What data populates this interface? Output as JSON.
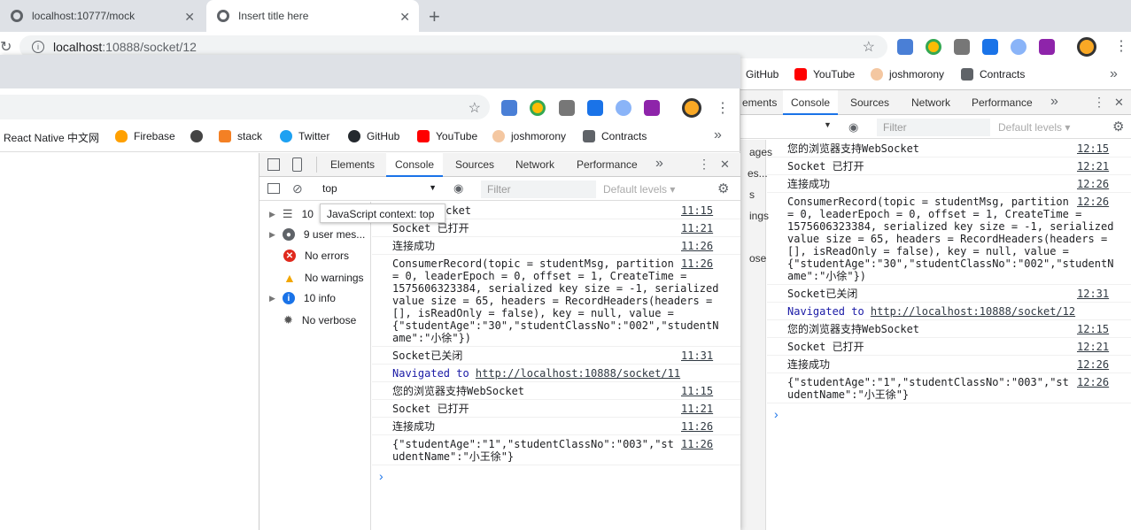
{
  "outer": {
    "tabs": [
      {
        "title": "localhost:10777/mock"
      },
      {
        "title": "Insert title here"
      }
    ],
    "new_tab": "+",
    "url_host": "localhost",
    "url_rest": ":10888/socket/12",
    "bookmarks": [
      "GitHub",
      "YouTube",
      "joshmorony",
      "Contracts"
    ],
    "bookmarks_more": "»",
    "devtools": {
      "tabs": [
        "ements",
        "Console",
        "Sources",
        "Network",
        "Performance"
      ],
      "more": "»",
      "filter_placeholder": "Filter",
      "levels": "Default levels ▾",
      "side_fragments": [
        "ages",
        "es...",
        "s",
        "ings",
        "ose"
      ],
      "messages": [
        {
          "text": "您的浏览器支持WebSocket",
          "src": "12:15"
        },
        {
          "text": "Socket 已打开",
          "src": "12:21"
        },
        {
          "text": "连接成功",
          "src": "12:26"
        },
        {
          "text": "ConsumerRecord(topic = studentMsg, partition\n= 0, leaderEpoch = 0, offset = 1, CreateTime =\n1575606323384, serialized key size = -1, serialized\nvalue size = 65, headers = RecordHeaders(headers =\n[], isReadOnly = false), key = null, value =\n{\"studentAge\":\"30\",\"studentClassNo\":\"002\",\"studentN\name\":\"小徐\"})",
          "src": "12:26"
        },
        {
          "text": "Socket已关闭",
          "src": "12:31"
        },
        {
          "nav": "Navigated to ",
          "link": "http://localhost:10888/socket/12"
        },
        {
          "text": "您的浏览器支持WebSocket",
          "src": "12:15"
        },
        {
          "text": "Socket 已打开",
          "src": "12:21"
        },
        {
          "text": "连接成功",
          "src": "12:26"
        },
        {
          "text": "{\"studentAge\":\"1\",\"studentClassNo\":\"003\",\"st\nudentName\":\"小王徐\"}",
          "src": "12:26"
        }
      ],
      "prompt": "›"
    }
  },
  "inner": {
    "bookmarks": [
      "React Native 中文网",
      "Firebase",
      "",
      "stack",
      "Twitter",
      "GitHub",
      "YouTube",
      "joshmorony",
      "Contracts"
    ],
    "bookmarks_more": "»",
    "devtools": {
      "tabs": [
        "Elements",
        "Console",
        "Sources",
        "Network",
        "Performance"
      ],
      "more": "»",
      "context": "top",
      "filter_placeholder": "Filter",
      "levels": "Default levels ▾",
      "tooltip": "JavaScript context: top",
      "sidebar": [
        {
          "label": "10",
          "icon": "list-icon"
        },
        {
          "label": "9 user mes...",
          "icon": "user-icon"
        },
        {
          "label": "No errors",
          "icon": "error-icon"
        },
        {
          "label": "No warnings",
          "icon": "warning-icon"
        },
        {
          "label": "10 info",
          "icon": "info-icon"
        },
        {
          "label": "No verbose",
          "icon": "bug-icon"
        }
      ],
      "messages": [
        {
          "text": "支持WebSocket",
          "src": "11:15"
        },
        {
          "text": "Socket 已打开",
          "src": "11:21"
        },
        {
          "text": "连接成功",
          "src": "11:26"
        },
        {
          "text": "ConsumerRecord(topic = studentMsg, partition\n= 0, leaderEpoch = 0, offset = 1, CreateTime =\n1575606323384, serialized key size = -1, serialized\nvalue size = 65, headers = RecordHeaders(headers =\n[], isReadOnly = false), key = null, value =\n{\"studentAge\":\"30\",\"studentClassNo\":\"002\",\"studentN\name\":\"小徐\"})",
          "src": "11:26"
        },
        {
          "text": "Socket已关闭",
          "src": "11:31"
        },
        {
          "nav": "Navigated to ",
          "link": "http://localhost:10888/socket/11"
        },
        {
          "text": "您的浏览器支持WebSocket",
          "src": "11:15"
        },
        {
          "text": "Socket 已打开",
          "src": "11:21"
        },
        {
          "text": "连接成功",
          "src": "11:26"
        },
        {
          "text": "{\"studentAge\":\"1\",\"studentClassNo\":\"003\",\"st\nudentName\":\"小王徐\"}",
          "src": "11:26"
        }
      ],
      "prompt": "›"
    }
  }
}
